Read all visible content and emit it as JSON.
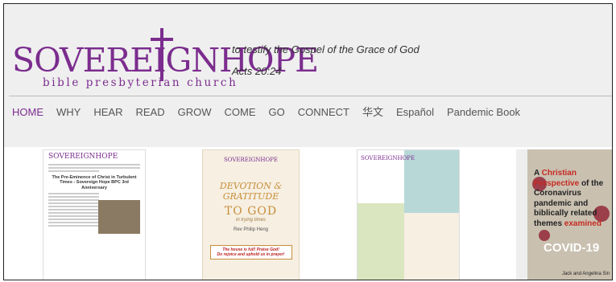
{
  "site": {
    "logo_word": "SOVEREIGNHOPE",
    "logo_sub": "bible presbyterian church",
    "tagline": "to testify the Gospel of the Grace of God",
    "verse": "Acts 20:24",
    "brand_color": "#7b2d8e"
  },
  "nav": {
    "items": [
      "HOME",
      "WHY",
      "HEAR",
      "READ",
      "GROW",
      "COME",
      "GO",
      "CONNECT",
      "华文",
      "Español",
      "Pandemic Book"
    ],
    "active": "HOME"
  },
  "thumbnails": [
    {
      "logo": "SOVEREIGNHOPE",
      "title": "The Pre-Eminence of Christ in Turbulent Times - Sovereign Hope BPC 3rd Anniversary"
    },
    {
      "logo": "SOVEREIGNHOPE",
      "heading": "DEVOTION & GRATITUDE",
      "subheading": "TO GOD",
      "subheading2": "in trying times",
      "author": "Rev Philip Heng",
      "box_line1": "The house is full! Praise God!",
      "box_line2": "Do rejoice and uphold us in prayer!"
    },
    {
      "logo": "SOVEREIGNHOPE"
    },
    {
      "title_prefix": "A",
      "title_highlight1": "Christian Perspective",
      "title_mid": "of the Coronavirus pandemic and biblically related themes",
      "title_highlight2": "examined",
      "covid_label": "COVID-19",
      "authors": "Jack and Angelina Sin"
    }
  ]
}
